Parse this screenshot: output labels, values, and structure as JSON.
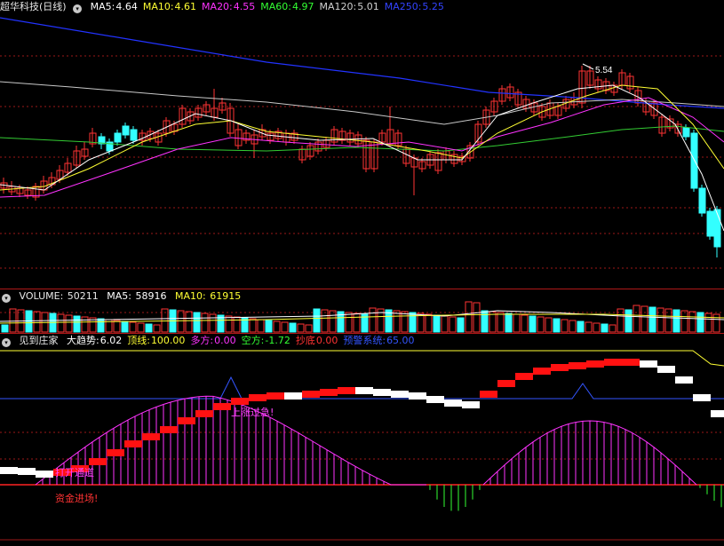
{
  "kline": {
    "stock_name": "超华科技(日线)",
    "menu_icon": "circle-dropdown-icon",
    "ma": [
      {
        "label": "MA5:",
        "value": "4.64",
        "color": "#ffffff"
      },
      {
        "label": "MA10:",
        "value": "4.61",
        "color": "#ffff33"
      },
      {
        "label": "MA20:",
        "value": "4.55",
        "color": "#ff33ff"
      },
      {
        "label": "MA60:",
        "value": "4.97",
        "color": "#33ff33"
      },
      {
        "label": "MA120:",
        "value": "5.01",
        "color": "#d0d0d0"
      },
      {
        "label": "MA250:",
        "value": "5.25",
        "color": "#3344ff"
      }
    ],
    "high_label": "5.54"
  },
  "volume": {
    "title": "VOLUME:",
    "value": "50211",
    "ma5_label": "MA5:",
    "ma5_value": "58916",
    "ma10_label": "MA10:",
    "ma10_value": "61915"
  },
  "indicator": {
    "name": "见到庄家",
    "items": [
      {
        "label": "大趋势:",
        "value": "6.02",
        "color": "#ffffff"
      },
      {
        "label": "顶线:",
        "value": "100.00",
        "color": "#ffff33"
      },
      {
        "label": "多方:",
        "value": "0.00",
        "color": "#ff33ff"
      },
      {
        "label": "空方:",
        "value": "-1.72",
        "color": "#33ff33"
      },
      {
        "label": "抄底",
        "value": "0.00",
        "color": "#ff3333"
      },
      {
        "label": "预警系统:",
        "value": "65.00",
        "color": "#3355ff"
      }
    ],
    "annotations": {
      "rise_too_fast": "上涨过急!",
      "open_channel": "打开通道",
      "funds_enter": "资金进场!"
    }
  },
  "colors": {
    "up": "#ff3333",
    "down": "#33ffff",
    "grid": "#9b1818"
  }
}
